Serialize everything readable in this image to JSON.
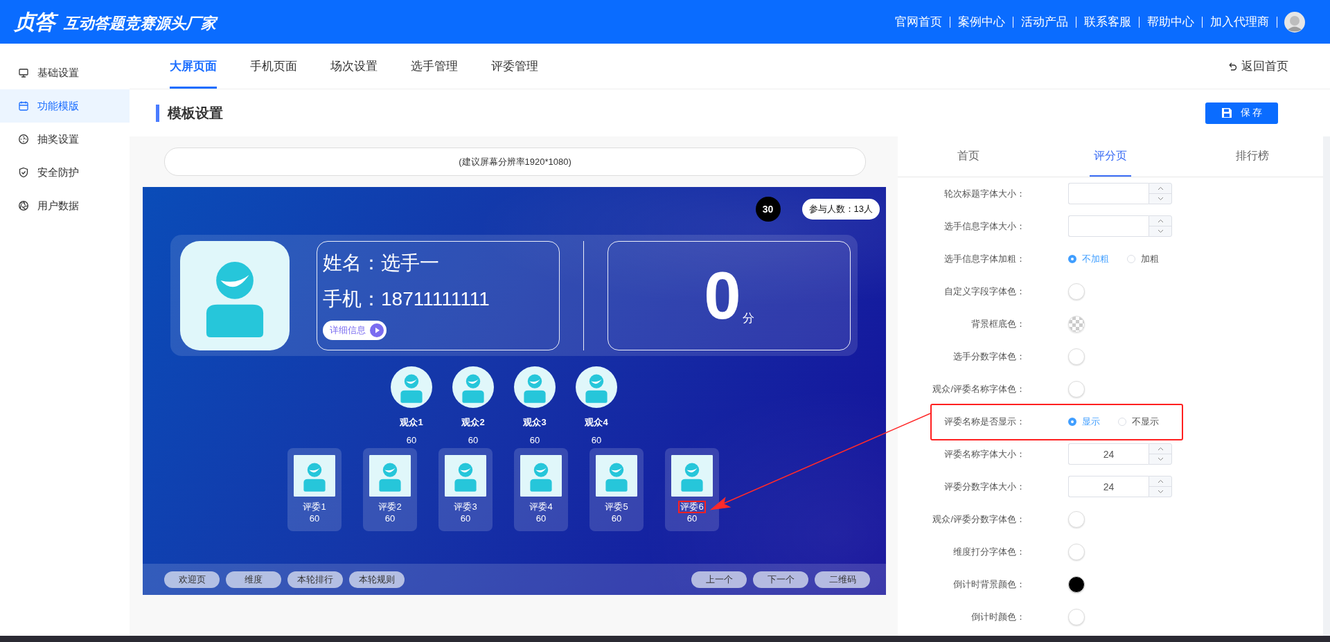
{
  "header": {
    "logo_mark": "贞答",
    "slogan": "互动答题竞赛源头厂家",
    "nav": [
      "官网首页",
      "案例中心",
      "活动产品",
      "联系客服",
      "帮助中心",
      "加入代理商"
    ]
  },
  "sidebar": {
    "items": [
      {
        "label": "基础设置",
        "selected": false
      },
      {
        "label": "功能模版",
        "selected": true
      },
      {
        "label": "抽奖设置",
        "selected": false
      },
      {
        "label": "安全防护",
        "selected": false
      },
      {
        "label": "用户数据",
        "selected": false
      }
    ]
  },
  "top_tabs": [
    {
      "label": "大屏页面",
      "selected": true
    },
    {
      "label": "手机页面",
      "selected": false
    },
    {
      "label": "场次设置",
      "selected": false
    },
    {
      "label": "选手管理",
      "selected": false
    },
    {
      "label": "评委管理",
      "selected": false
    }
  ],
  "back_link": "返回首页",
  "section_title": "模板设置",
  "save_button": "保 存",
  "preview": {
    "resolution_hint": "(建议屏幕分辨率1920*1080)",
    "countdown": "30",
    "participants": "参与人数：13人",
    "contestant": {
      "name_line": "姓名：选手一",
      "phone_line": "手机：18711111111",
      "detail_button": "详细信息"
    },
    "score": "0",
    "score_unit": "分",
    "audience": [
      {
        "name": "观众1",
        "score": "60"
      },
      {
        "name": "观众2",
        "score": "60"
      },
      {
        "name": "观众3",
        "score": "60"
      },
      {
        "name": "观众4",
        "score": "60"
      }
    ],
    "judges": [
      {
        "name": "评委1",
        "score": "60",
        "highlighted": false
      },
      {
        "name": "评委2",
        "score": "60",
        "highlighted": false
      },
      {
        "name": "评委3",
        "score": "60",
        "highlighted": false
      },
      {
        "name": "评委4",
        "score": "60",
        "highlighted": false
      },
      {
        "name": "评委5",
        "score": "60",
        "highlighted": false
      },
      {
        "name": "评委6",
        "score": "60",
        "highlighted": true
      }
    ],
    "left_buttons": [
      "欢迎页",
      "维度",
      "本轮排行",
      "本轮规则"
    ],
    "right_buttons": [
      "上一个",
      "下一个",
      "二维码"
    ]
  },
  "settings": {
    "tabs": [
      {
        "label": "首页",
        "selected": false
      },
      {
        "label": "评分页",
        "selected": true
      },
      {
        "label": "排行榜",
        "selected": false
      }
    ],
    "rows": [
      {
        "kind": "number",
        "label": "轮次标题字体大小："
      },
      {
        "kind": "number",
        "label": "选手信息字体大小："
      },
      {
        "kind": "radio",
        "label": "选手信息字体加粗：",
        "highlighted": false,
        "options": [
          {
            "label": "不加粗",
            "selected": true
          },
          {
            "label": "加粗",
            "selected": false
          }
        ]
      },
      {
        "kind": "color",
        "label": "自定义字段字体色：",
        "color": "#ffffff"
      },
      {
        "kind": "clear",
        "label": "背景框底色："
      },
      {
        "kind": "color",
        "label": "选手分数字体色：",
        "color": "#ffffff"
      },
      {
        "kind": "color",
        "label": "观众/评委名称字体色：",
        "color": "#ffffff"
      },
      {
        "kind": "radio",
        "label": "评委名称是否显示：",
        "highlighted": true,
        "options": [
          {
            "label": "显示",
            "selected": true
          },
          {
            "label": "不显示",
            "selected": false
          }
        ]
      },
      {
        "kind": "number",
        "label": "评委名称字体大小：",
        "value": "24"
      },
      {
        "kind": "number",
        "label": "评委分数字体大小：",
        "value": "24"
      },
      {
        "kind": "color",
        "label": "观众/评委分数字体色：",
        "color": "#ffffff"
      },
      {
        "kind": "color",
        "label": "维度打分字体色：",
        "color": "#ffffff"
      },
      {
        "kind": "color",
        "label": "倒计时背景颜色：",
        "color": "#000000"
      },
      {
        "kind": "color",
        "label": "倒计时颜色：",
        "color": "#ffffff"
      }
    ]
  }
}
